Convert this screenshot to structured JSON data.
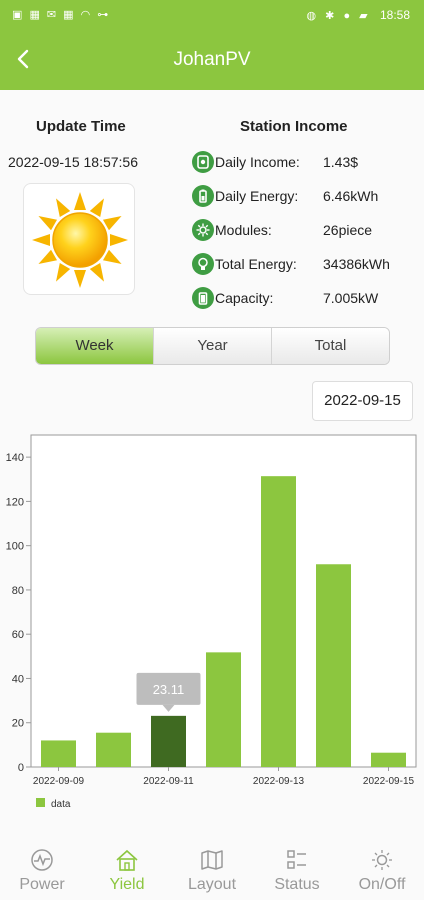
{
  "status_bar": {
    "time": "18:58"
  },
  "header": {
    "title": "JohanPV"
  },
  "update": {
    "title": "Update Time",
    "datetime": "2022-09-15 18:57:56",
    "weather_icon": "sun-icon"
  },
  "income": {
    "title": "Station Income",
    "rows": [
      {
        "label": "Daily Income:",
        "value": "1.43$",
        "icon": "income-icon"
      },
      {
        "label": "Daily Energy:",
        "value": "6.46kWh",
        "icon": "battery-icon"
      },
      {
        "label": "Modules:",
        "value": "26piece",
        "icon": "modules-icon"
      },
      {
        "label": "Total Energy:",
        "value": "34386kWh",
        "icon": "bulb-icon"
      },
      {
        "label": "Capacity:",
        "value": "7.005kW",
        "icon": "capacity-icon"
      }
    ]
  },
  "tabs": {
    "week": "Week",
    "year": "Year",
    "total": "Total",
    "selected": "Week"
  },
  "date_picker": {
    "value": "2022-09-15"
  },
  "chart_data": {
    "type": "bar",
    "categories": [
      "2022-09-09",
      "2022-09-10",
      "2022-09-11",
      "2022-09-12",
      "2022-09-13",
      "2022-09-14",
      "2022-09-15"
    ],
    "x_tick_labels": [
      "2022-09-09",
      "2022-09-11",
      "2022-09-13",
      "2022-09-15"
    ],
    "series": [
      {
        "name": "data",
        "values": [
          12.0,
          15.5,
          23.11,
          51.8,
          131.4,
          91.6,
          6.46
        ]
      }
    ],
    "ylim": [
      0,
      150
    ],
    "yticks": [
      0,
      20,
      40,
      60,
      80,
      100,
      120,
      140
    ],
    "highlight_index": 2,
    "tooltip": "23.11",
    "legend": "bottom-left",
    "grid": false,
    "bar_color": "#8cc63f",
    "highlight_color": "#3f6a21"
  },
  "bottom_nav": {
    "items": [
      {
        "label": "Power",
        "icon": "power-icon"
      },
      {
        "label": "Yield",
        "icon": "home-icon"
      },
      {
        "label": "Layout",
        "icon": "map-icon"
      },
      {
        "label": "Status",
        "icon": "status-icon"
      },
      {
        "label": "On/Off",
        "icon": "onoff-icon"
      }
    ],
    "active": "Yield"
  },
  "colors": {
    "brand": "#8cc63f",
    "icon_green": "#3f9d43",
    "inactive": "#999999"
  }
}
